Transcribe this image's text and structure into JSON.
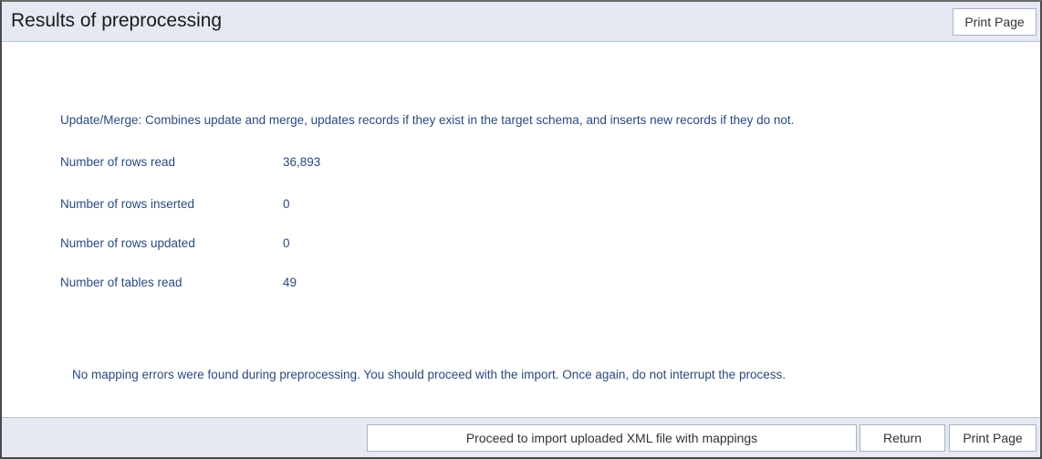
{
  "header": {
    "title": "Results of preprocessing",
    "print_label": "Print Page"
  },
  "main": {
    "description": "Update/Merge: Combines update and merge, updates records if they exist in the target schema, and inserts new records if they do not.",
    "stats": [
      {
        "label": "Number of rows read",
        "value": "36,893"
      },
      {
        "label": "Number of rows inserted",
        "value": "0"
      },
      {
        "label": "Number of rows updated",
        "value": "0"
      },
      {
        "label": "Number of tables read",
        "value": "49"
      }
    ],
    "note": "No mapping errors were found during preprocessing. You should proceed with the import. Once again, do not interrupt the process."
  },
  "footer": {
    "proceed_label": "Proceed to import uploaded XML file with mappings",
    "return_label": "Return",
    "print_label": "Print Page"
  },
  "colors": {
    "bar_background": "#e4e9f2",
    "text_blue": "#2a4a7e"
  }
}
